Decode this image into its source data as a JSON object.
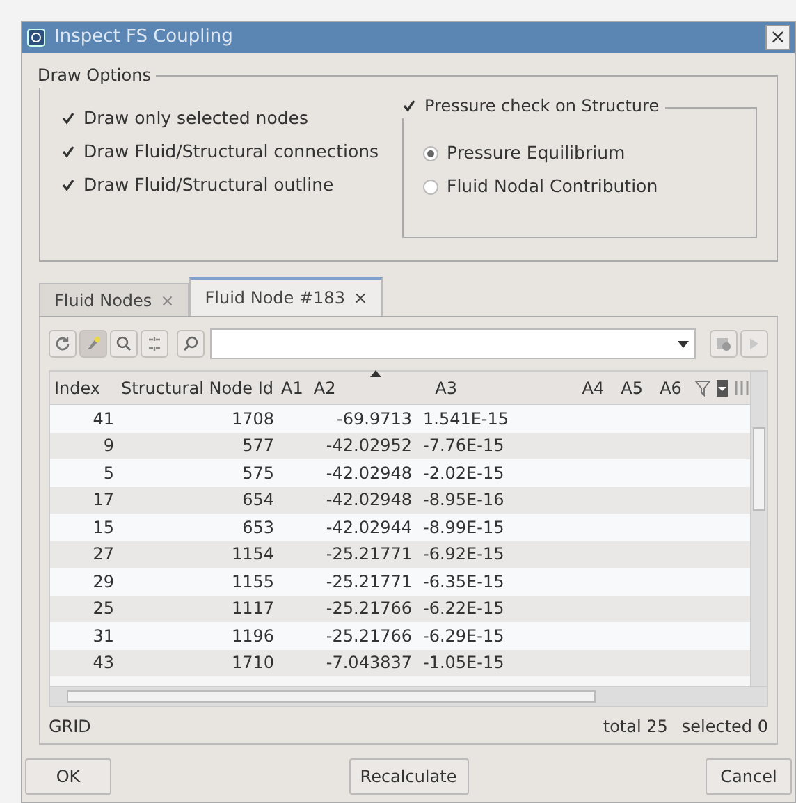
{
  "window": {
    "title": "Inspect FS Coupling",
    "close": "×"
  },
  "draw_options": {
    "title": "Draw Options",
    "checkboxes": [
      {
        "label": "Draw only selected nodes",
        "checked": true
      },
      {
        "label": "Draw Fluid/Structural connections",
        "checked": true
      },
      {
        "label": "Draw Fluid/Structural outline",
        "checked": true
      }
    ],
    "pressure_check": {
      "label": "Pressure check on Structure",
      "checked": true,
      "radios": [
        {
          "label": "Pressure Equilibrium",
          "selected": true
        },
        {
          "label": "Fluid Nodal Contribution",
          "selected": false
        }
      ]
    }
  },
  "tabs": [
    {
      "label": "Fluid Nodes",
      "close": "×",
      "selected": false
    },
    {
      "label": "Fluid Node #183",
      "close": "×",
      "selected": true
    }
  ],
  "table": {
    "columns": [
      {
        "label": "Index",
        "sorted": false
      },
      {
        "label": "Structural Node Id",
        "sorted": false
      },
      {
        "label": "A1",
        "sorted": false
      },
      {
        "label": "A2",
        "sorted": true
      },
      {
        "label": "A3",
        "sorted": false
      },
      {
        "label": "A4",
        "sorted": false
      },
      {
        "label": "A5",
        "sorted": false
      },
      {
        "label": "A6",
        "sorted": false
      }
    ],
    "rows": [
      [
        "41",
        "1708",
        "-69.9713",
        "1.541E-15"
      ],
      [
        "9",
        "577",
        "-42.02952",
        "-7.76E-15"
      ],
      [
        "5",
        "575",
        "-42.02948",
        "-2.02E-15"
      ],
      [
        "17",
        "654",
        "-42.02948",
        "-8.95E-16"
      ],
      [
        "15",
        "653",
        "-42.02944",
        "-8.99E-15"
      ],
      [
        "27",
        "1154",
        "-25.21771",
        "-6.92E-15"
      ],
      [
        "29",
        "1155",
        "-25.21771",
        "-6.35E-15"
      ],
      [
        "25",
        "1117",
        "-25.21766",
        "-6.22E-15"
      ],
      [
        "31",
        "1196",
        "-25.21766",
        "-6.29E-15"
      ],
      [
        "43",
        "1710",
        "-7.043837",
        "-1.05E-15"
      ]
    ]
  },
  "status_bar": {
    "left": "GRID",
    "total": "total 25",
    "selected": "selected 0"
  },
  "buttons": [
    "OK",
    "Recalculate",
    "Cancel"
  ]
}
